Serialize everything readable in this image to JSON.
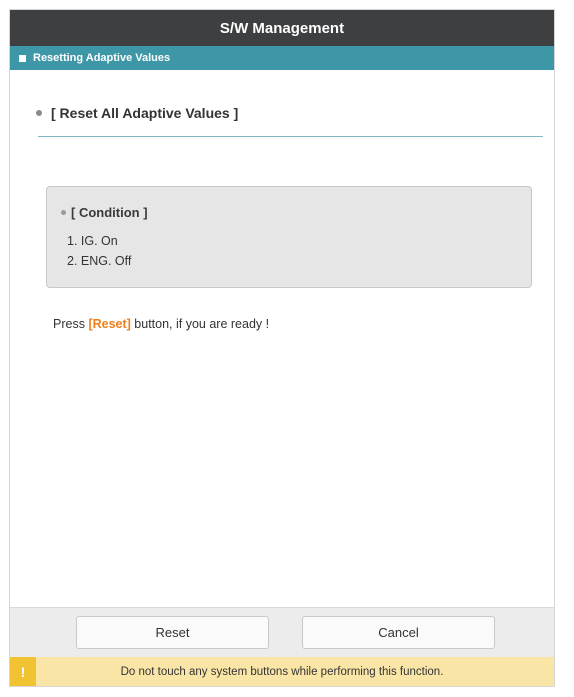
{
  "window": {
    "title": "S/W Management"
  },
  "subtitle": {
    "label": "Resetting Adaptive Values"
  },
  "section": {
    "heading": "[ Reset All Adaptive Values ]"
  },
  "condition": {
    "title": "[ Condition ]",
    "items": [
      "1. IG. On",
      "2. ENG. Off"
    ]
  },
  "instruction": {
    "prefix": "Press ",
    "highlight": "[Reset]",
    "suffix": " button, if you are ready !"
  },
  "buttons": {
    "reset_label": "Reset",
    "cancel_label": "Cancel"
  },
  "warning": {
    "icon": "!",
    "text": "Do not touch any system buttons while performing this function."
  },
  "colors": {
    "titlebar": "#3d3f41",
    "subtitlebar": "#3d97a6",
    "accent": "#f07e1b",
    "warning_bg": "#f9e6a7",
    "warning_icon_bg": "#f1c232"
  }
}
